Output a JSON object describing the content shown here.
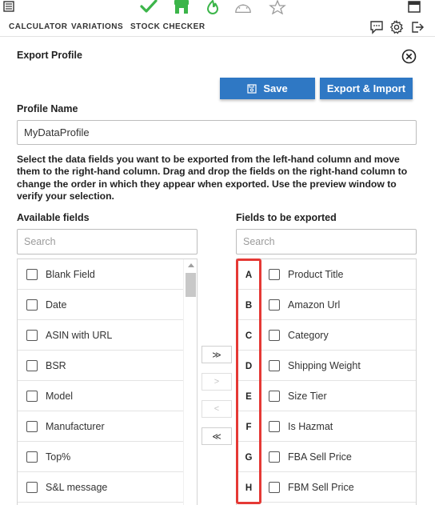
{
  "toolbar_icons": [
    "menu-icon",
    "checkmark-icon",
    "shop-icon",
    "flame-icon",
    "dashboard-icon",
    "star-icon",
    "window-icon"
  ],
  "accent_color": "#2f78c4",
  "highlight_color": "#e53935",
  "nav": {
    "tabs": [
      "CALCULATOR",
      "VARIATIONS",
      "STOCK CHECKER"
    ],
    "icons": [
      "chat-icon",
      "gear-icon",
      "logout-icon"
    ]
  },
  "panel": {
    "title": "Export Profile",
    "save_label": "Save",
    "export_label": "Export & Import",
    "profile_name_label": "Profile Name",
    "profile_name_value": "MyDataProfile",
    "instructions": "Select the data fields you want to be exported from the left-hand column and move them to the right-hand column. Drag and drop the fields on the right-hand column to change the order in which they appear when exported. Use the preview window to verify your selection."
  },
  "available": {
    "heading": "Available fields",
    "search_placeholder": "Search",
    "items": [
      "Blank Field",
      "Date",
      "ASIN with URL",
      "BSR",
      "Model",
      "Manufacturer",
      "Top%",
      "S&L message"
    ]
  },
  "exported": {
    "heading": "Fields to be exported",
    "search_placeholder": "Search",
    "items": [
      {
        "letter": "A",
        "label": "Product Title"
      },
      {
        "letter": "B",
        "label": "Amazon Url"
      },
      {
        "letter": "C",
        "label": "Category"
      },
      {
        "letter": "D",
        "label": "Shipping Weight"
      },
      {
        "letter": "E",
        "label": "Size Tier"
      },
      {
        "letter": "F",
        "label": "Is Hazmat"
      },
      {
        "letter": "G",
        "label": "FBA Sell Price"
      },
      {
        "letter": "H",
        "label": "FBM Sell Price"
      }
    ]
  },
  "move_buttons": [
    {
      "label": "≫",
      "enabled": true
    },
    {
      "label": ">",
      "enabled": false
    },
    {
      "label": "<",
      "enabled": false
    },
    {
      "label": "≪",
      "enabled": true
    }
  ]
}
